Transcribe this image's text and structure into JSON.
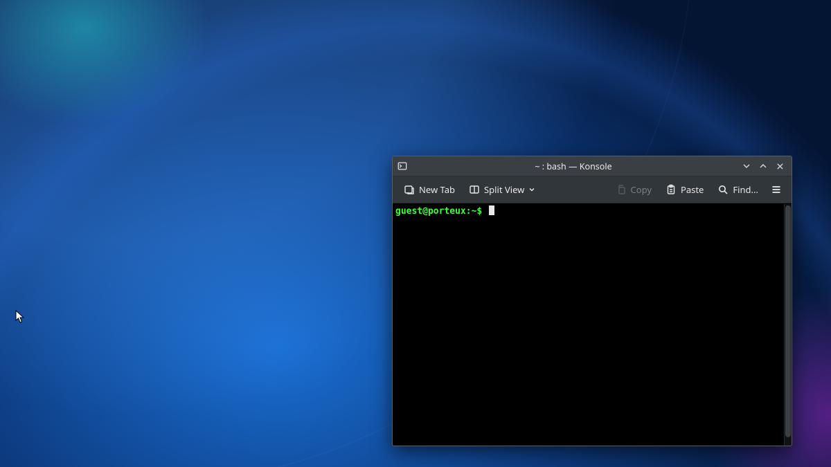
{
  "window": {
    "title": "~ : bash — Konsole"
  },
  "toolbar": {
    "new_tab": "New Tab",
    "split_view": "Split View",
    "copy": "Copy",
    "paste": "Paste",
    "find": "Find..."
  },
  "terminal": {
    "prompt": "guest@porteux:~$"
  }
}
